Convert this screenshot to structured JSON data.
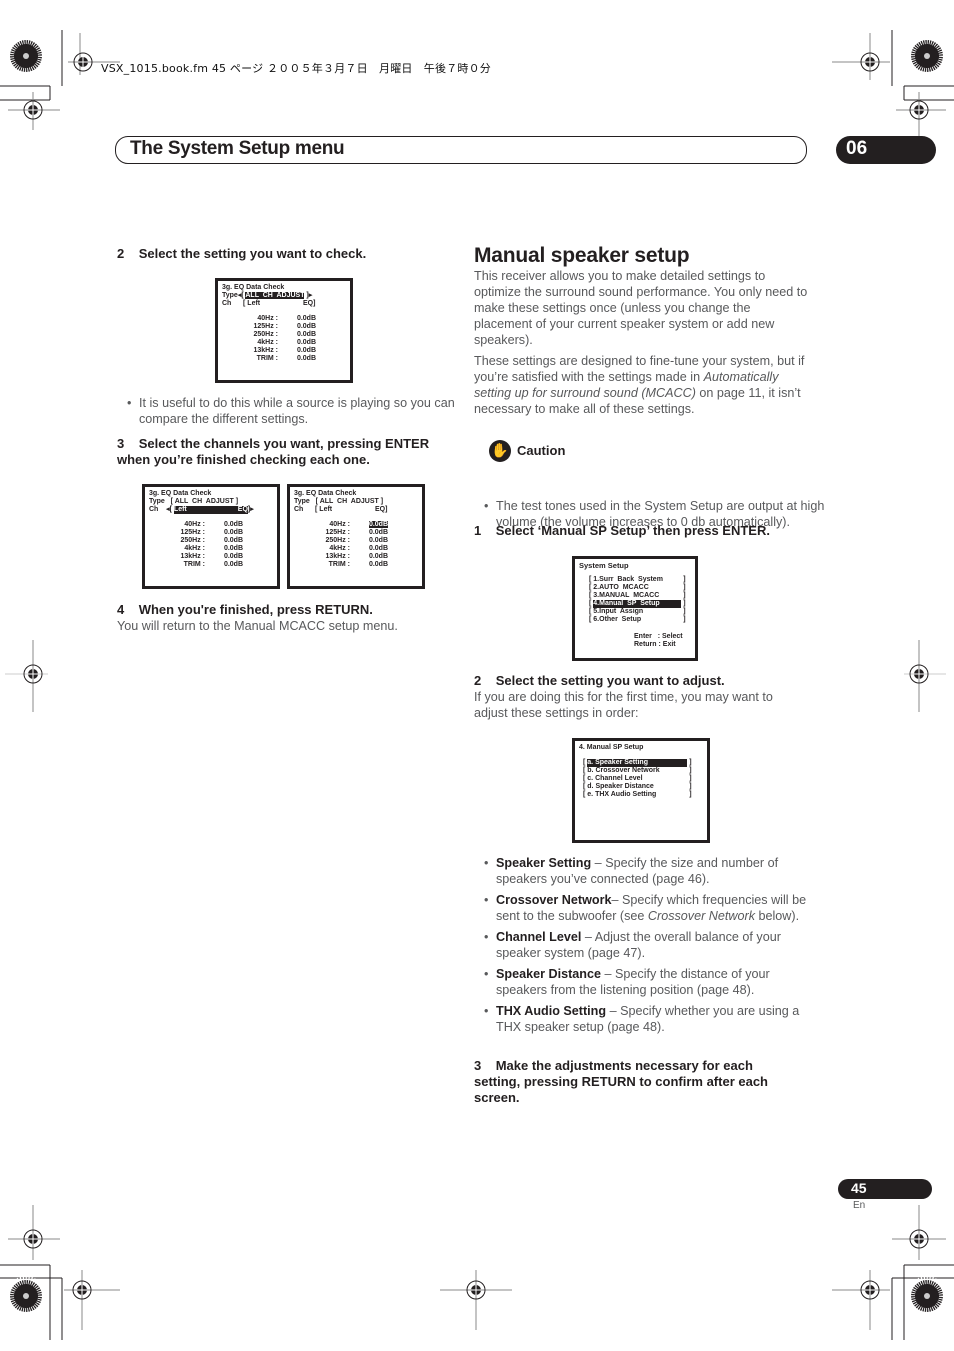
{
  "print_header": "VSX_1015.book.fm  45 ページ  ２００５年３月７日　月曜日　午後７時０分",
  "chapter": {
    "title": "The System Setup menu",
    "number": "06"
  },
  "left_column": {
    "step2": {
      "num": "2",
      "text": "Select the setting you want to check."
    },
    "screen1": {
      "title": "3g. EQ Data Check",
      "type_label": "Type",
      "type_value": "ALL  CH  ADJUST",
      "ch_label": "Ch",
      "ch_value": "Left",
      "ch_suffix": "EQ",
      "rows": [
        {
          "freq": "40Hz :",
          "val": "0.0dB"
        },
        {
          "freq": "125Hz :",
          "val": "0.0dB"
        },
        {
          "freq": "250Hz :",
          "val": "0.0dB"
        },
        {
          "freq": "4kHz :",
          "val": "0.0dB"
        },
        {
          "freq": "13kHz :",
          "val": "0.0dB"
        },
        {
          "freq": "TRIM :",
          "val": "0.0dB"
        }
      ]
    },
    "tip": "It is useful to do this while a source is playing so you can compare the different settings.",
    "step3": {
      "num": "3",
      "text": "Select the channels you want, pressing ENTER when you’re finished checking each one."
    },
    "screen2": {
      "title": "3g. EQ Data Check",
      "type_label": "Type",
      "type_value": "ALL  CH  ADJUST",
      "ch_label": "Ch",
      "ch_value": "Left",
      "ch_suffix": "EQ",
      "rows": [
        {
          "freq": "40Hz :",
          "val": "0.0dB"
        },
        {
          "freq": "125Hz :",
          "val": "0.0dB"
        },
        {
          "freq": "250Hz :",
          "val": "0.0dB"
        },
        {
          "freq": "4kHz :",
          "val": "0.0dB"
        },
        {
          "freq": "13kHz :",
          "val": "0.0dB"
        },
        {
          "freq": "TRIM :",
          "val": "0.0dB"
        }
      ]
    },
    "screen3": {
      "title": "3g. EQ Data Check",
      "type_label": "Type",
      "type_value": "ALL  CH  ADJUST",
      "ch_label": "Ch",
      "ch_value": "Left",
      "ch_suffix": "EQ",
      "rows": [
        {
          "freq": "40Hz :",
          "val": "0.0dB"
        },
        {
          "freq": "125Hz :",
          "val": "0.0dB"
        },
        {
          "freq": "250Hz :",
          "val": "0.0dB"
        },
        {
          "freq": "4kHz :",
          "val": "0.0dB"
        },
        {
          "freq": "13kHz :",
          "val": "0.0dB"
        },
        {
          "freq": "TRIM :",
          "val": "0.0dB"
        }
      ]
    },
    "step4": {
      "num": "4",
      "text": "When you're finished, press RETURN."
    },
    "step4_body": "You will return to the Manual MCACC setup menu."
  },
  "right_column": {
    "heading": "Manual speaker setup",
    "intro1": "This receiver allows you to make detailed settings to optimize the surround sound performance. You only need to make these settings once (unless you change the placement of your current speaker system or add new speakers).",
    "intro2_a": "These settings are designed to fine-tune your system, but if you’re satisfied with the settings made in ",
    "intro2_italic": "Automatically setting up for surround sound (MCACC)",
    "intro2_b": " on page 11, it isn’t necessary to make all of these settings.",
    "caution": {
      "label": "Caution",
      "text": "The test tones used in the System Setup are output at high volume (the volume increases to 0 db automatically)."
    },
    "step1": {
      "num": "1",
      "text": "Select ‘Manual SP Setup’ then press ENTER."
    },
    "system_setup_screen": {
      "title": "System Setup",
      "items": [
        "1.Surr  Back  System",
        "2.AUTO  MCACC",
        "3.MANUAL  MCACC",
        "4.Manual  SP  Setup",
        "5.Input  Assign",
        "6.Other  Setup"
      ],
      "selected_index": 3,
      "footer": [
        "Enter   : Select",
        "Return : Exit"
      ]
    },
    "step2": {
      "num": "2",
      "text": "Select the setting you want to adjust."
    },
    "step2_body": "If you are doing this for the first time, you may want to adjust these settings in order:",
    "manual_sp_screen": {
      "title": "4. Manual SP Setup",
      "items": [
        "a. Speaker Setting",
        "b. Crossover Network",
        "c. Channel Level",
        "d. Speaker Distance",
        "e. THX Audio Setting"
      ],
      "selected_index": 0
    },
    "settings": [
      {
        "name": "Speaker Setting",
        "desc": " – Specify the size and number of speakers you’ve connected (page 46).",
        "italic": "",
        "desc2": ""
      },
      {
        "name": "Crossover Network",
        "desc": "– Specify which frequencies will be sent to the subwoofer (see ",
        "italic": "Crossover Network",
        "desc2": " below)."
      },
      {
        "name": "Channel Level",
        "desc": " – Adjust the overall balance of your speaker system (page 47).",
        "italic": "",
        "desc2": ""
      },
      {
        "name": "Speaker Distance",
        "desc": " – Specify the distance of your speakers from the listening position (page 48).",
        "italic": "",
        "desc2": ""
      },
      {
        "name": "THX Audio Setting",
        "desc": " – Specify whether you are using a THX speaker setup (page 48).",
        "italic": "",
        "desc2": ""
      }
    ],
    "step3": {
      "num": "3",
      "text": "Make the adjustments necessary for each setting, pressing RETURN to confirm after each screen."
    }
  },
  "footer": {
    "page_number": "45",
    "language": "En"
  }
}
